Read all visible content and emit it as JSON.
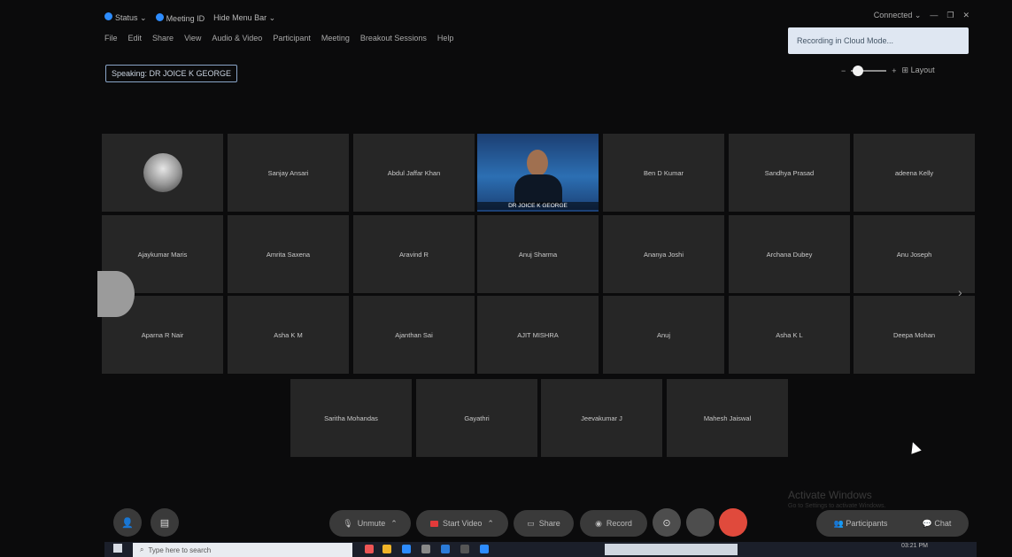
{
  "titlebar": {
    "view_label": "Status ⌄",
    "meeting_id": "Meeting ID",
    "hide_menu": "Hide Menu Bar ⌄"
  },
  "menubar": [
    "File",
    "Edit",
    "Share",
    "View",
    "Audio & Video",
    "Participant",
    "Meeting",
    "Breakout Sessions",
    "Help"
  ],
  "window_controls": {
    "connected": "Connected ⌄",
    "minimize": "—",
    "maximize": "❐",
    "close": "✕"
  },
  "notification": "Recording in Cloud Mode...",
  "speaking": "Speaking: DR JOICE K GEORGE",
  "layout_label": "Layout",
  "active_video_label": "DR JOICE K GEORGE",
  "participants_row1": [
    "",
    "Sanjay Ansari",
    "Abdul Jaffar Khan",
    "",
    "Ben D Kumar",
    "Sandhya Prasad",
    "adeena Kelly"
  ],
  "participants_row2": [
    "Ajaykumar Maris",
    "Amrita Saxena",
    "Aravind R",
    "Anuj Sharma",
    "Ananya Joshi",
    "Archana Dubey",
    "Anu Joseph"
  ],
  "participants_row3": [
    "Aparna R Nair",
    "Asha K M",
    "Ajanthan Sai",
    "AJIT MISHRA",
    "Anuj",
    "Asha K L",
    "Deepa Mohan"
  ],
  "participants_row4": [
    "Saritha Mohandas",
    "Gayathri",
    "Jeevakumar J",
    "Mahesh Jaiswal"
  ],
  "watermark": {
    "title": "Activate Windows",
    "subtitle": "Go to Settings to activate Windows."
  },
  "toolbar": {
    "unmute": "Unmute",
    "start_video": "Start Video",
    "share": "Share",
    "record": "Record",
    "participants": "Participants",
    "chat": "Chat"
  },
  "taskbar": {
    "search_placeholder": "Type here to search",
    "time": "03:21 PM"
  }
}
